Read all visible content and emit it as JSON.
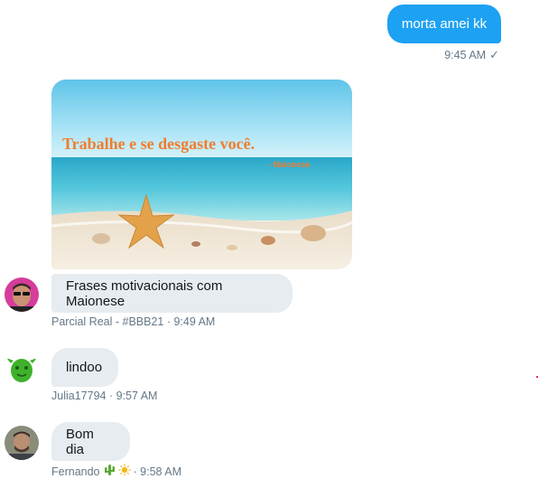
{
  "outgoing": {
    "text": "morta amei kk",
    "time": "9:45 AM",
    "status_icon": "check-icon",
    "accent": "#1da1f2"
  },
  "media": {
    "quote": "Trabalhe e se desgaste você.",
    "signature": "- Maionese"
  },
  "messages": [
    {
      "text": "Frases motivacionais com Maionese",
      "meta": "Parcial Real - #BBB21 · 9:49 AM"
    },
    {
      "text": "lindoo",
      "meta": "Julia17794 · 9:57 AM"
    },
    {
      "text": "Bom dia",
      "meta_name": "Fernando",
      "meta_time": "· 9:58 AM",
      "meta_icons": [
        "cactus-icon",
        "sun-icon"
      ]
    }
  ],
  "colors": {
    "incoming_bubble": "#e6ecf0",
    "meta_text": "#657786"
  }
}
